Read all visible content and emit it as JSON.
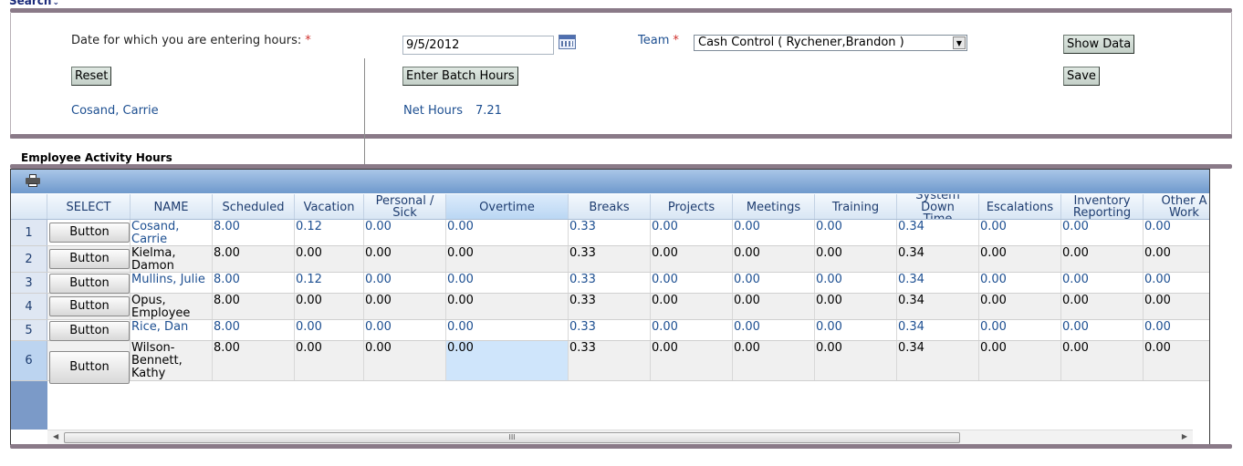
{
  "search": {
    "title": "Search"
  },
  "form": {
    "date_label": "Date for which you are entering hours:",
    "required_mark": "*",
    "date_value": "9/5/2012",
    "team_label": "Team",
    "team_value": "Cash Control ( Rychener,Brandon )",
    "show_data": "Show Data",
    "reset": "Reset",
    "enter_batch_hours": "Enter Batch Hours",
    "save": "Save",
    "employee_name": "Cosand, Carrie",
    "net_hours_label": "Net Hours",
    "net_hours_value": "7.21"
  },
  "grid": {
    "title": "Employee Activity Hours",
    "button_label": "Button",
    "scroll_grip": "III",
    "columns": [
      "SELECT",
      "NAME",
      "Scheduled",
      "Vacation",
      "Personal /\nSick",
      "Overtime",
      "Breaks",
      "Projects",
      "Meetings",
      "Training",
      "System Down\nTime",
      "Escalations",
      "Inventory\nReporting",
      "Other A\nWork"
    ],
    "rows": [
      {
        "num": "1",
        "name": "Cosand,\nCarrie",
        "values": [
          "8.00",
          "0.12",
          "0.00",
          "0.00",
          "0.33",
          "0.00",
          "0.00",
          "0.00",
          "0.34",
          "0.00",
          "0.00",
          "0.00"
        ]
      },
      {
        "num": "2",
        "name": "Kielma,\nDamon",
        "values": [
          "8.00",
          "0.00",
          "0.00",
          "0.00",
          "0.33",
          "0.00",
          "0.00",
          "0.00",
          "0.34",
          "0.00",
          "0.00",
          "0.00"
        ]
      },
      {
        "num": "3",
        "name": "Mullins, Julie",
        "values": [
          "8.00",
          "0.12",
          "0.00",
          "0.00",
          "0.33",
          "0.00",
          "0.00",
          "0.00",
          "0.34",
          "0.00",
          "0.00",
          "0.00"
        ]
      },
      {
        "num": "4",
        "name": "Opus,\nEmployee",
        "values": [
          "8.00",
          "0.00",
          "0.00",
          "0.00",
          "0.33",
          "0.00",
          "0.00",
          "0.00",
          "0.34",
          "0.00",
          "0.00",
          "0.00"
        ]
      },
      {
        "num": "5",
        "name": "Rice, Dan",
        "values": [
          "8.00",
          "0.00",
          "0.00",
          "0.00",
          "0.33",
          "0.00",
          "0.00",
          "0.00",
          "0.34",
          "0.00",
          "0.00",
          "0.00"
        ]
      },
      {
        "num": "6",
        "name": "Wilson-\nBennett,\nKathy",
        "values": [
          "8.00",
          "0.00",
          "0.00",
          "0.00",
          "0.33",
          "0.00",
          "0.00",
          "0.00",
          "0.34",
          "0.00",
          "0.00",
          "0.00"
        ]
      }
    ]
  },
  "colors": {
    "link": "#1d4f91",
    "required": "#d0302c",
    "toolbar": "#6f99cc",
    "selected_cell": "#cfe5fb"
  },
  "icons": [
    "chevron-down-icon",
    "calendar-icon",
    "dropdown-arrow-icon",
    "print-icon"
  ]
}
